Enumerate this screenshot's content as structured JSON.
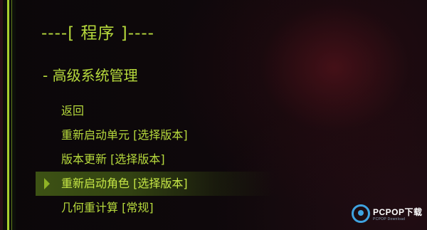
{
  "screen": {
    "title": "----[ 程序 ]----",
    "subtitle": "- 高级系统管理"
  },
  "menu": {
    "items": [
      {
        "label": "返回",
        "selected": false
      },
      {
        "label": "重新启动单元 [选择版本]",
        "selected": false
      },
      {
        "label": "版本更新 [选择版本]",
        "selected": false
      },
      {
        "label": "重新启动角色 [选择版本]",
        "selected": true
      },
      {
        "label": "几何重计算 [常规]",
        "selected": false
      }
    ]
  },
  "watermark": {
    "text": "PCPOP下载",
    "subtext": "PCPOP Download"
  },
  "colors": {
    "text": "#b6d93c",
    "accent": "#a8d12e",
    "selection": "#465f16",
    "background": "#0a0709",
    "watermark": "#3fa3e0"
  }
}
